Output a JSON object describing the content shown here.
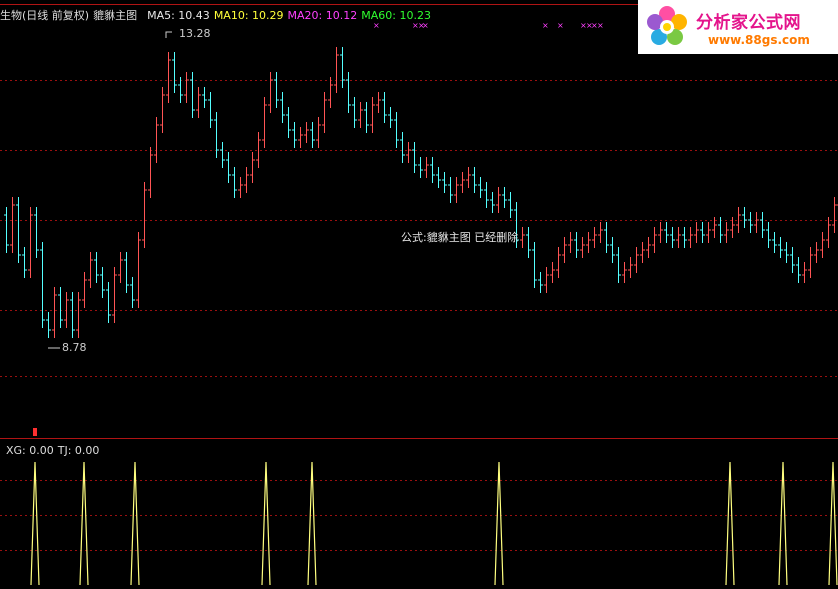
{
  "header": {
    "title": "生物(日线 前复权)",
    "formula": "貔貅主图",
    "ma": [
      {
        "label": "MA5: 10.43",
        "color": "#e8e8e8"
      },
      {
        "label": "MA10: 10.29",
        "color": "#ffff3a"
      },
      {
        "label": "MA20: 10.12",
        "color": "#ff40ff"
      },
      {
        "label": "MA60: 10.23",
        "color": "#30ff30"
      }
    ]
  },
  "labels": {
    "high": "13.28",
    "low": "8.78"
  },
  "notice": "公式:貔貅主图 已经删除",
  "indicator": {
    "xg": "XG: 0.00",
    "tj": "TJ: 0.00"
  },
  "logo": {
    "cn": "分析家公式网",
    "url": "www.88gs.com"
  },
  "colors": {
    "up": "#ff5454",
    "down": "#54ffff",
    "grid": "#9a1010",
    "signal": "#ffff80",
    "marker": "#ff40ff"
  },
  "chart_data": {
    "type": "candlestick",
    "price_high": 13.28,
    "price_low": 8.78,
    "signal_marker_count": 9,
    "signal_spikes": 10
  }
}
